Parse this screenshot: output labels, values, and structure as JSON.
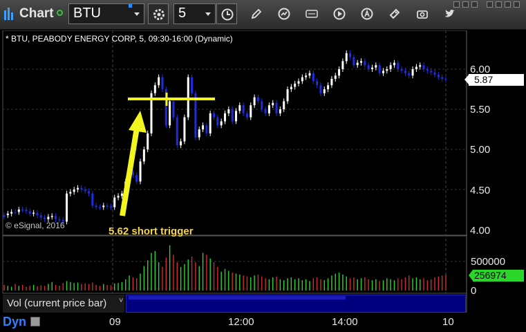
{
  "toolbar": {
    "app_title": "Chart",
    "symbol": "BTU",
    "interval": "5",
    "buttons": [
      "gear-icon",
      "clock-icon",
      "pencil-icon",
      "speedometer-icon",
      "get-icon",
      "play-icon",
      "alert-icon",
      "tag-icon",
      "camera-icon",
      "twitter-icon"
    ]
  },
  "chart": {
    "title": "* BTU, PEABODY ENERGY CORP, 5, 09:30-16:00 (Dynamic)",
    "copyright": "© eSignal, 2016",
    "annotation": "5.62 short trigger",
    "last_price": "5.87",
    "trigger_level": 5.62,
    "colors": {
      "up": "#ffffff",
      "down": "#1f2de0",
      "annotation": "#f2f51e",
      "vol_up": "#2bd62b",
      "vol_down": "#d62b2b"
    }
  },
  "chart_data": {
    "type": "candlestick",
    "y_ticks": [
      "6.00",
      "5.50",
      "5.00",
      "4.50",
      "4.00"
    ],
    "ylim": [
      4.0,
      6.3
    ],
    "x_ticks": [
      "09",
      "12:00",
      "14:00",
      "10"
    ],
    "series": [
      {
        "name": "BTU",
        "close": [
          4.18,
          4.2,
          4.22,
          4.22,
          4.25,
          4.25,
          4.23,
          4.2,
          4.21,
          4.18,
          4.15,
          4.13,
          4.16,
          4.17,
          4.13,
          4.12,
          4.1,
          4.45,
          4.47,
          4.5,
          4.52,
          4.5,
          4.48,
          4.45,
          4.3,
          4.28,
          4.28,
          4.3,
          4.29,
          4.28,
          4.4,
          4.42,
          4.45,
          4.6,
          4.72,
          4.68,
          4.6,
          4.85,
          5.0,
          5.2,
          5.7,
          5.8,
          5.9,
          5.75,
          5.3,
          5.6,
          5.4,
          5.05,
          5.1,
          5.4,
          5.9,
          5.7,
          5.15,
          5.25,
          5.3,
          5.2,
          5.45,
          5.4,
          5.3,
          5.35,
          5.45,
          5.5,
          5.35,
          5.48,
          5.55,
          5.45,
          5.4,
          5.55,
          5.65,
          5.6,
          5.5,
          5.45,
          5.55,
          5.58,
          5.45,
          5.5,
          5.6,
          5.75,
          5.78,
          5.82,
          5.85,
          5.9,
          5.92,
          5.95,
          5.85,
          5.8,
          5.7,
          5.75,
          5.8,
          5.88,
          5.92,
          6.0,
          6.1,
          6.2,
          6.15,
          6.05,
          6.08,
          6.1,
          6.05,
          6.0,
          6.02,
          6.05,
          5.95,
          5.98,
          6.0,
          6.05,
          6.08,
          6.0,
          5.98,
          5.95,
          5.92,
          6.0,
          6.03,
          6.05,
          6.0,
          5.98,
          5.96,
          5.93,
          5.9,
          5.88,
          5.87
        ],
        "volume": [
          60,
          50,
          40,
          70,
          50,
          60,
          40,
          50,
          60,
          45,
          55,
          50,
          70,
          90,
          60,
          50,
          80,
          100,
          90,
          80,
          85,
          70,
          75,
          70,
          85,
          60,
          50,
          70,
          60,
          55,
          75,
          80,
          90,
          120,
          160,
          140,
          130,
          180,
          260,
          320,
          400,
          420,
          300,
          250,
          350,
          480,
          380,
          300,
          250,
          280,
          330,
          360,
          300,
          260,
          400,
          380,
          340,
          300,
          250,
          200,
          230,
          210,
          190,
          180,
          170,
          160,
          150,
          140,
          160,
          170,
          150,
          130,
          120,
          140,
          150,
          120,
          110,
          130,
          140,
          120,
          130,
          110,
          120,
          100,
          130,
          140,
          120,
          110,
          130,
          160,
          180,
          190,
          170,
          150,
          130,
          140,
          120,
          130,
          140,
          120,
          110,
          120,
          100,
          110,
          130,
          120,
          110,
          130,
          120,
          140,
          160,
          130,
          140,
          120,
          130,
          110,
          120,
          140,
          150,
          160,
          170
        ],
        "up": [
          0,
          1,
          1,
          0,
          1,
          0,
          0,
          0,
          1,
          0,
          0,
          0,
          1,
          1,
          0,
          0,
          0,
          1,
          1,
          1,
          1,
          0,
          0,
          0,
          0,
          0,
          0,
          1,
          0,
          0,
          1,
          1,
          1,
          1,
          1,
          0,
          0,
          1,
          1,
          1,
          1,
          1,
          1,
          0,
          0,
          1,
          0,
          0,
          1,
          1,
          1,
          0,
          0,
          1,
          1,
          0,
          1,
          0,
          0,
          1,
          1,
          1,
          0,
          1,
          1,
          0,
          0,
          1,
          1,
          0,
          0,
          0,
          1,
          1,
          0,
          1,
          1,
          1,
          1,
          1,
          1,
          1,
          1,
          1,
          0,
          0,
          0,
          1,
          1,
          1,
          1,
          1,
          1,
          1,
          0,
          0,
          1,
          1,
          0,
          0,
          1,
          1,
          0,
          1,
          1,
          1,
          1,
          0,
          0,
          0,
          0,
          1,
          1,
          1,
          0,
          0,
          0,
          0,
          0,
          0,
          0
        ]
      }
    ],
    "volume_ticks": [
      "500000",
      "0"
    ],
    "last_volume": "256974"
  },
  "bottom": {
    "panel_label": "Vol (current price bar)",
    "link_label": "Dyn"
  }
}
